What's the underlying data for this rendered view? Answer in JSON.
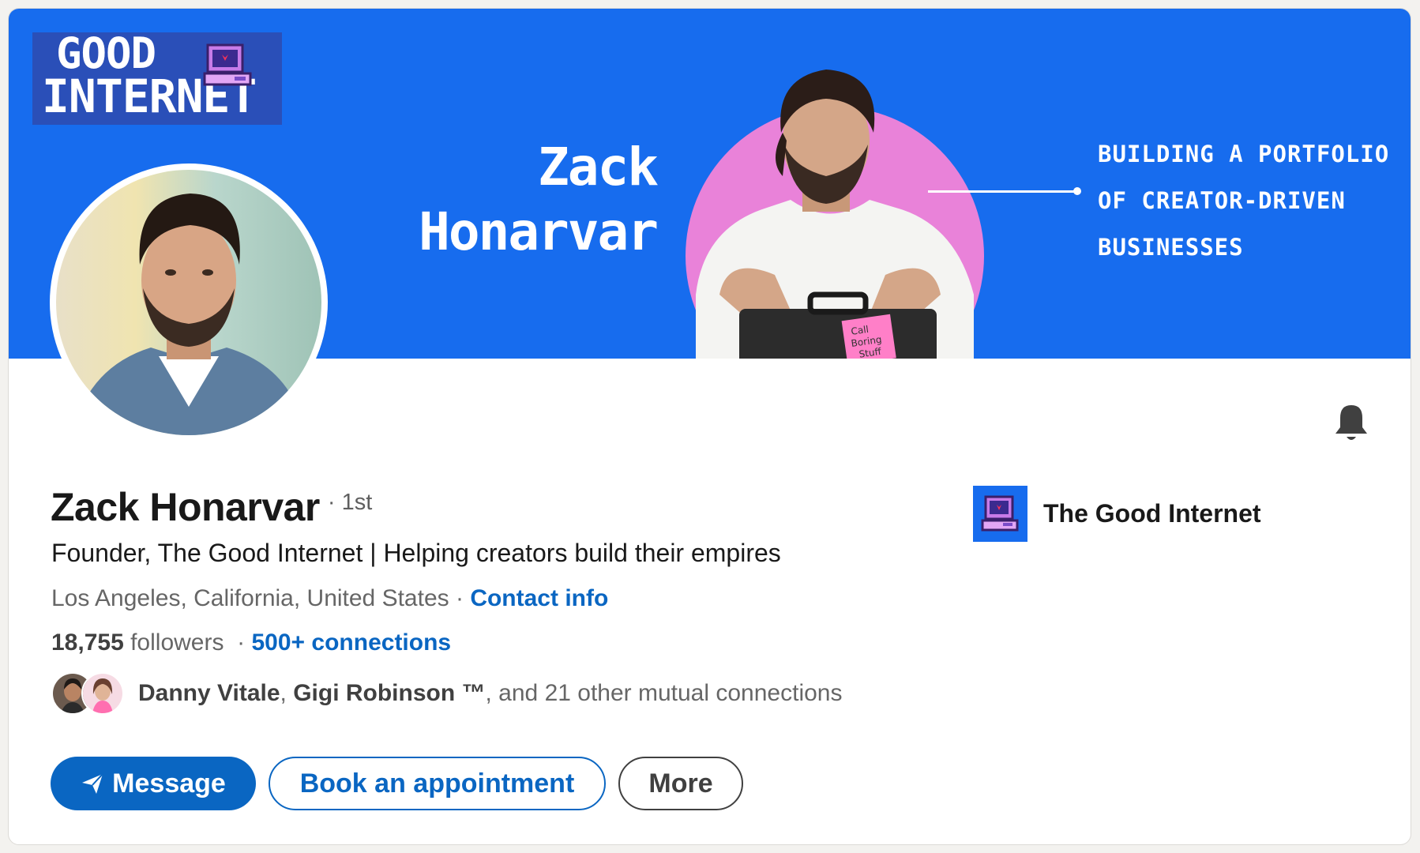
{
  "banner": {
    "logo_line1": "GOOD",
    "logo_line2": "INTERNET",
    "name_line1": "Zack",
    "name_line2": "Honarvar",
    "tagline": [
      "BUILDING A PORTFOLIO",
      "OF CREATOR-DRIVEN",
      "BUSINESSES"
    ],
    "sticky_note": [
      "Call",
      "Boring",
      "Stuff"
    ]
  },
  "profile": {
    "name": "Zack Honarvar",
    "degree": "· 1st",
    "headline": "Founder, The Good Internet | Helping creators build their empires",
    "location": "Los Angeles, California, United States",
    "separator": " · ",
    "contact_info": "Contact info",
    "followers_count": "18,755",
    "followers_label": " followers",
    "connections": "500+ connections",
    "mutual": {
      "name1": "Danny Vitale",
      "name2": "Gigi Robinson ™",
      "rest": ", and 21 other mutual connections"
    }
  },
  "actions": {
    "message": "Message",
    "book": "Book an appointment",
    "more": "More"
  },
  "company": {
    "name": "The Good Internet"
  },
  "colors": {
    "banner_blue": "#176cee",
    "link_blue": "#0a66c2",
    "pink": "#e982d9"
  },
  "icons": [
    "bell-icon",
    "send-icon",
    "computer-icon"
  ]
}
